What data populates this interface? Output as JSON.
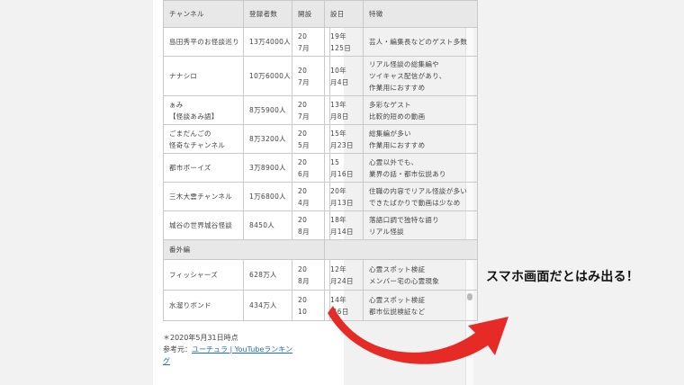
{
  "left_table": {
    "headers": [
      "チャンネル",
      "登録者数",
      "開設"
    ],
    "rows": [
      {
        "name": "島田秀平のお怪談巡り",
        "subs": "13万4000人",
        "open": "20\n7月"
      },
      {
        "name": "ナナシロ",
        "subs": "10万6000人",
        "open": "20\n7月"
      },
      {
        "name": "ぁみ\n【怪談あみ語】",
        "subs": "8万5900人",
        "open": "20\n7月"
      },
      {
        "name": "ごまだんごの\n怪奇なチャンネル",
        "subs": "8万3200人",
        "open": "20\n5月"
      },
      {
        "name": "都市ボーイズ",
        "subs": "3万8900人",
        "open": "20\n6月"
      },
      {
        "name": "三木大雲チャンネル",
        "subs": "1万6800人",
        "open": "20\n4月"
      },
      {
        "name": "城谷の世界城谷怪談",
        "subs": "8450人",
        "open": "20\n8月"
      }
    ],
    "section": "番外編",
    "extra_rows": [
      {
        "name": "フィッシャーズ",
        "subs": "628万人",
        "open": "20\n8月"
      },
      {
        "name": "水溜りボンド",
        "subs": "434万人",
        "open": "20\n10"
      }
    ]
  },
  "right_table": {
    "headers": [
      "設日",
      "特徴"
    ],
    "rows": [
      {
        "date": "19年\n125日",
        "feature": "芸人・編集長などのゲスト多数"
      },
      {
        "date": "10年\n月4日",
        "feature": "リアル怪談の総集編や\nツイキャス配信があり、\n作業用におすすめ"
      },
      {
        "date": "13年\n月8日",
        "feature": "多彩なゲスト\n比較的短めの動画"
      },
      {
        "date": "15年\n月23日",
        "feature": "総集編が多い\n作業用におすすめ"
      },
      {
        "date": "15\n月16日",
        "feature": "心霊以外でも、\n業界の話・都市伝説あり"
      },
      {
        "date": "20年\n月13日",
        "feature": "住職の内容でリアル怪談が多い\nできたばかりで動画は少なめ"
      },
      {
        "date": "18年\n月14日",
        "feature": "落語口調で独特な語り\nリアル怪談"
      }
    ],
    "extra_rows": [
      {
        "date": "12年\n月24日",
        "feature": "心霊スポット検証\nメンバー宅の心霊現象"
      },
      {
        "date": "14年\n月6日",
        "feature": "心霊スポット検証\n都市伝説検証など"
      }
    ]
  },
  "note": {
    "line1": "＊2020年5月31日時点",
    "line2_prefix": "参考元：",
    "link": "ユーチュラ | YouTubeランキン",
    "link_cont": "グ"
  },
  "caption": "スマホ画面だとはみ出る！",
  "colors": {
    "arrow": "#e62a26",
    "header_bg": "#e8e8e8",
    "link": "#1e6fbf"
  }
}
